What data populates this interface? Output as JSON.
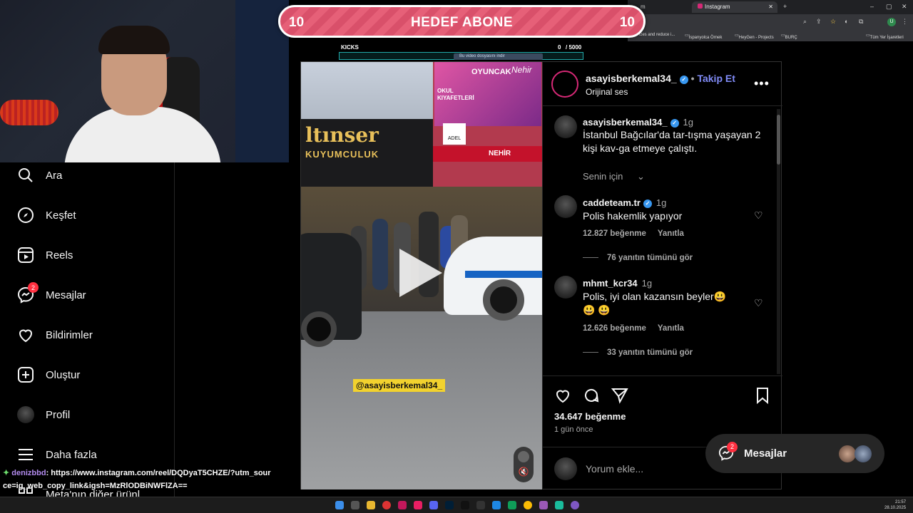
{
  "browser": {
    "tabs": [
      {
        "label": "m"
      },
      {
        "label": "Instagram"
      }
    ],
    "bookmarks": [
      "izes and reduce i...",
      "İspanyolca Örnek",
      "HeyGen - Projects",
      "BURÇ",
      "Tüm Yer İşaretleri"
    ],
    "profile_initial": "U"
  },
  "overlay": {
    "goal_left": "10",
    "goal_title": "HEDEF ABONE",
    "goal_right": "10",
    "kicks_label": "KICKS",
    "kicks_count": "0",
    "kicks_total": "/ 5000",
    "download_label": "Bu video dosyasını indir"
  },
  "sidebar": {
    "items": [
      {
        "label": "Ara",
        "icon": "search-icon"
      },
      {
        "label": "Keşfet",
        "icon": "compass-icon"
      },
      {
        "label": "Reels",
        "icon": "reels-icon"
      },
      {
        "label": "Mesajlar",
        "icon": "messenger-icon",
        "badge": "2"
      },
      {
        "label": "Bildirimler",
        "icon": "heart-icon"
      },
      {
        "label": "Oluştur",
        "icon": "plus-square-icon"
      },
      {
        "label": "Profil",
        "icon": "avatar-icon"
      },
      {
        "label": "Daha fazla",
        "icon": "menu-icon"
      },
      {
        "label": "Meta'nın diğer ürünl",
        "icon": "meta-icon"
      }
    ]
  },
  "chat": {
    "user": "denizbbd",
    "message": ": https://www.instagram.com/reel/DQDyaT5CHZE/?utm_source=ig_web_copy_link&igsh=MzRlODBiNWFlZA=="
  },
  "video": {
    "store_sign": "ltınser",
    "store_sub": "KUYUMCULUK",
    "shop_words": [
      "OYUNCAK",
      "OKUL KIYAFETLERİ",
      "Nehir",
      "ADEL",
      "NEHİR"
    ],
    "watermark": "@asayisberkemal34_"
  },
  "post": {
    "username": "asayisberkemal34_",
    "follow_label": "Takip Et",
    "audio": "Orijinal ses",
    "caption_user": "asayisberkemal34_",
    "caption_time": "1g",
    "caption": "İstanbul Bağcılar'da tar-tışma yaşayan 2 kişi kav-ga etmeye çalıştı.",
    "for_you": "Senin için",
    "comments": [
      {
        "user": "caddeteam.tr",
        "verified": true,
        "time": "1g",
        "text": "Polis hakemlik yapıyor",
        "likes": "12.827 beğenme",
        "reply": "Yanıtla",
        "replies": "76 yanıtın tümünü gör"
      },
      {
        "user": "mhmt_kcr34",
        "verified": false,
        "time": "1g",
        "text": "Polis, iyi olan kazansın beyler😃 😃 😃",
        "likes": "12.626 beğenme",
        "reply": "Yanıtla",
        "replies": "33 yanıtın tümünü gör"
      }
    ],
    "like_count": "34.647 beğenme",
    "posted_ago": "1 gün önce",
    "comment_placeholder": "Yorum ekle..."
  },
  "messages_popup": {
    "label": "Mesajlar",
    "badge": "2"
  },
  "taskbar": {
    "time": "21:57",
    "date": "28.10.2025"
  }
}
